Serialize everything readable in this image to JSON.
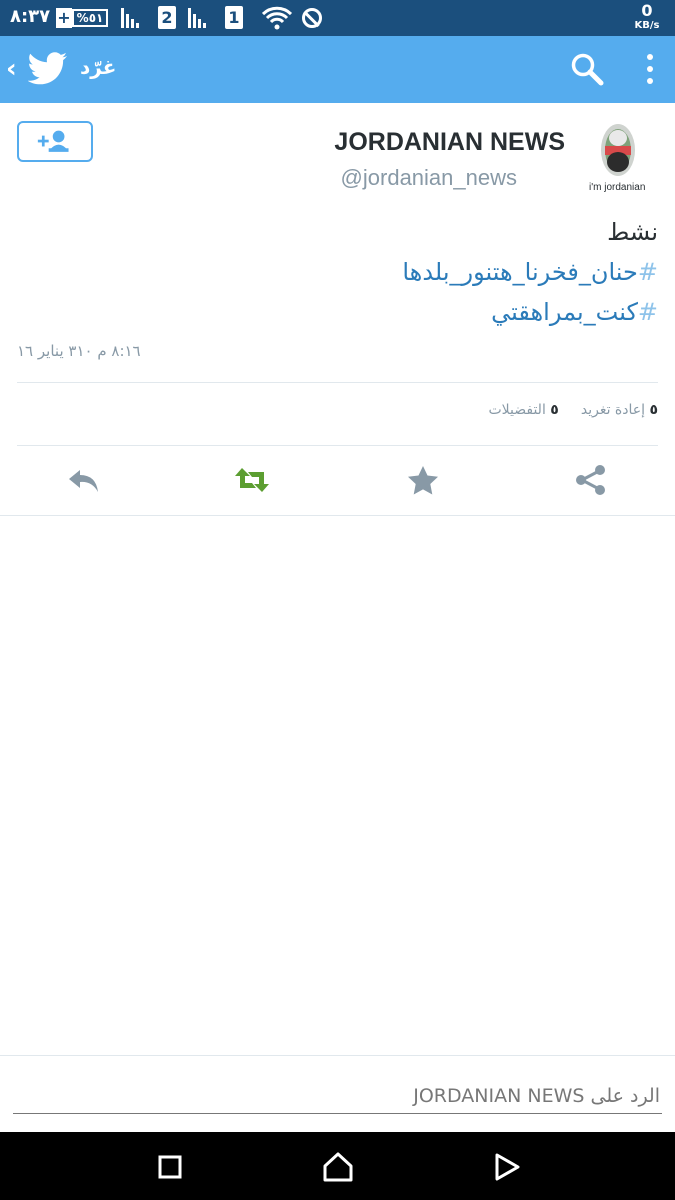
{
  "status_bar": {
    "time": "٨:٣٧",
    "battery_percent": "%٥١",
    "sim1": "2",
    "sim2": "1",
    "network_speed": "0",
    "network_unit": "KB/s",
    "bg_color": "#1b4f7d"
  },
  "app_bar": {
    "title": "غرّد",
    "bg_color": "#55acee",
    "icons": [
      "chevron-left-icon",
      "twitter-bird-icon",
      "search-icon",
      "overflow-menu-icon"
    ]
  },
  "tweet": {
    "display_name": "JORDANIAN NEWS",
    "handle": "@jordanian_news",
    "avatar_caption": "i'm jordanian",
    "text_line": "نشط",
    "hashtags": [
      {
        "hash": "#",
        "tag": "حنان_فخرنا_هتنور_بلدها"
      },
      {
        "hash": "#",
        "tag": "كنت_بمراهقتي"
      }
    ],
    "timestamp": "٨:١٦ م ٣١٠ يناير ١٦",
    "retweets": {
      "count": "٥",
      "label": "إعادة تغريد"
    },
    "favorites": {
      "count": "٥",
      "label": "التفضيلات"
    },
    "hashtag_color": "#2b7bb9"
  },
  "actions": [
    "reply-icon",
    "retweet-icon",
    "favorite-star-icon",
    "share-icon"
  ],
  "reply_box": {
    "placeholder": "الرد على JORDANIAN NEWS"
  },
  "nav_bar": [
    "recents-square-icon",
    "home-icon",
    "back-triangle-icon"
  ]
}
